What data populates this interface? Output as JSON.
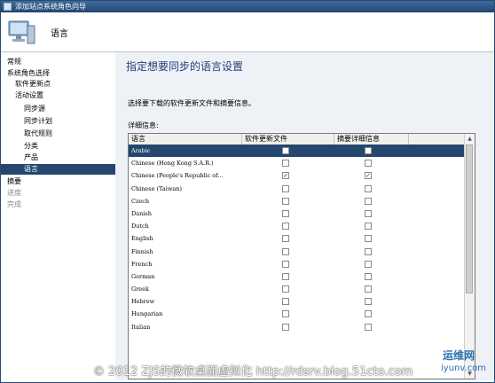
{
  "window": {
    "title": "添加站点系统角色向导"
  },
  "header": {
    "title": "语言"
  },
  "nav": [
    {
      "label": "常规",
      "level": 0,
      "state": "normal"
    },
    {
      "label": "系统角色选择",
      "level": 0,
      "state": "normal"
    },
    {
      "label": "软件更新点",
      "level": 1,
      "state": "normal"
    },
    {
      "label": "活动设置",
      "level": 1,
      "state": "normal"
    },
    {
      "label": "同步源",
      "level": 2,
      "state": "normal"
    },
    {
      "label": "同步计划",
      "level": 2,
      "state": "normal"
    },
    {
      "label": "取代规则",
      "level": 2,
      "state": "normal"
    },
    {
      "label": "分类",
      "level": 2,
      "state": "normal"
    },
    {
      "label": "产品",
      "level": 2,
      "state": "normal"
    },
    {
      "label": "语言",
      "level": 2,
      "state": "active"
    },
    {
      "label": "摘要",
      "level": 0,
      "state": "normal"
    },
    {
      "label": "进度",
      "level": 0,
      "state": "disabled"
    },
    {
      "label": "完成",
      "level": 0,
      "state": "disabled"
    }
  ],
  "main": {
    "title": "指定想要同步的语言设置",
    "instruction": "选择要下载的软件更新文件和摘要信息。",
    "details_label": "详细信息:"
  },
  "table": {
    "columns": [
      "语言",
      "软件更新文件",
      "摘要详细信息"
    ],
    "rows": [
      {
        "language": "Arabic",
        "files": false,
        "summary": false,
        "selected": true
      },
      {
        "language": "Chinese (Hong Kong S.A.R.)",
        "files": false,
        "summary": false,
        "selected": false
      },
      {
        "language": "Chinese (People's Republic of...",
        "files": true,
        "summary": true,
        "selected": false
      },
      {
        "language": "Chinese (Taiwan)",
        "files": false,
        "summary": false,
        "selected": false
      },
      {
        "language": "Czech",
        "files": false,
        "summary": false,
        "selected": false
      },
      {
        "language": "Danish",
        "files": false,
        "summary": false,
        "selected": false
      },
      {
        "language": "Dutch",
        "files": false,
        "summary": false,
        "selected": false
      },
      {
        "language": "English",
        "files": false,
        "summary": false,
        "selected": false
      },
      {
        "language": "Finnish",
        "files": false,
        "summary": false,
        "selected": false
      },
      {
        "language": "French",
        "files": false,
        "summary": false,
        "selected": false
      },
      {
        "language": "German",
        "files": false,
        "summary": false,
        "selected": false
      },
      {
        "language": "Greek",
        "files": false,
        "summary": false,
        "selected": false
      },
      {
        "language": "Hebrew",
        "files": false,
        "summary": false,
        "selected": false
      },
      {
        "language": "Hungarian",
        "files": false,
        "summary": false,
        "selected": false
      },
      {
        "language": "Italian",
        "files": false,
        "summary": false,
        "selected": false
      }
    ]
  },
  "watermark": "© 2012 ZJS的微软桌面虚拟化 http://rdsrv.blog.51cto.com",
  "logo": {
    "line1": "运维网",
    "line2": "iyunv.com"
  },
  "colors": {
    "accent": "#24466f",
    "title": "#1f3f7a",
    "content_bg": "#eef1f6"
  }
}
